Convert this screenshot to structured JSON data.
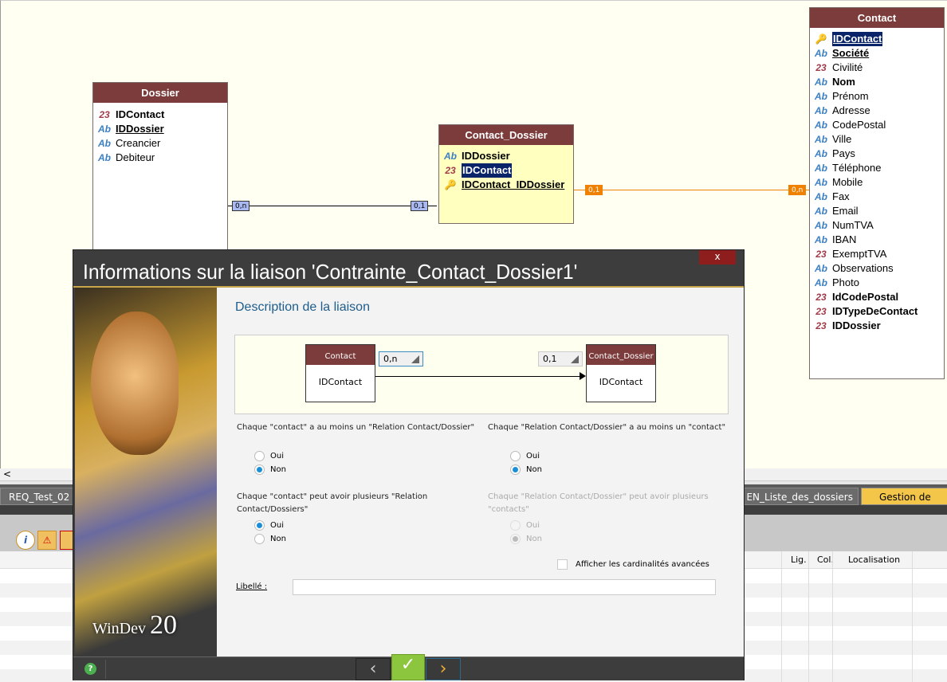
{
  "diagram": {
    "tables": [
      {
        "id": "dossier",
        "title": "Dossier",
        "fields": [
          {
            "name": "IDContact",
            "type": "num",
            "style": "b"
          },
          {
            "name": "IDDossier",
            "type": "ab",
            "style": "b u"
          },
          {
            "name": "Creancier",
            "type": "ab",
            "style": ""
          },
          {
            "name": "Debiteur",
            "type": "ab",
            "style": ""
          }
        ]
      },
      {
        "id": "contact_dossier",
        "title": "Contact_Dossier",
        "fields": [
          {
            "name": "IDDossier",
            "type": "ab",
            "style": "b"
          },
          {
            "name": "IDContact",
            "type": "num",
            "style": "b sel"
          },
          {
            "name": "IDContact_IDDossier",
            "type": "key",
            "style": "b u"
          }
        ]
      },
      {
        "id": "contact",
        "title": "Contact",
        "fields": [
          {
            "name": "IDContact",
            "type": "key",
            "style": "b u sel"
          },
          {
            "name": "Société",
            "type": "ab",
            "style": "b u"
          },
          {
            "name": "Civilité",
            "type": "num",
            "style": ""
          },
          {
            "name": "Nom",
            "type": "ab",
            "style": "b"
          },
          {
            "name": "Prénom",
            "type": "ab",
            "style": ""
          },
          {
            "name": "Adresse",
            "type": "ab",
            "style": ""
          },
          {
            "name": "CodePostal",
            "type": "ab",
            "style": ""
          },
          {
            "name": "Ville",
            "type": "ab",
            "style": ""
          },
          {
            "name": "Pays",
            "type": "ab",
            "style": ""
          },
          {
            "name": "Téléphone",
            "type": "ab",
            "style": ""
          },
          {
            "name": "Mobile",
            "type": "ab",
            "style": ""
          },
          {
            "name": "Fax",
            "type": "ab",
            "style": ""
          },
          {
            "name": "Email",
            "type": "ab",
            "style": ""
          },
          {
            "name": "NumTVA",
            "type": "ab",
            "style": ""
          },
          {
            "name": "IBAN",
            "type": "ab",
            "style": ""
          },
          {
            "name": "ExemptTVA",
            "type": "num",
            "style": ""
          },
          {
            "name": "Observations",
            "type": "ab",
            "style": ""
          },
          {
            "name": "Photo",
            "type": "ab",
            "style": ""
          },
          {
            "name": "IdCodePostal",
            "type": "num",
            "style": "b"
          },
          {
            "name": "IDTypeDeContact",
            "type": "num",
            "style": "b"
          },
          {
            "name": "IDDossier",
            "type": "num",
            "style": "b"
          }
        ]
      }
    ],
    "links": {
      "dossier_left": "0,n",
      "dossier_right": "0,1",
      "contact_left": "0,1",
      "contact_right": "0,n"
    },
    "icons": {
      "ab": "Ab",
      "num": "23",
      "key": "🔑"
    }
  },
  "tabs": [
    {
      "label": "REQ_Test_02"
    },
    {
      "label": "EN_Liste_des_dossiers"
    },
    {
      "label": "Gestion de créa"
    }
  ],
  "grid": {
    "columns": [
      "Lig.",
      "Col.",
      "Localisation"
    ]
  },
  "dialog": {
    "title": "Informations sur la liaison 'Contrainte_Contact_Dossier1'",
    "close": "x",
    "section": "Description de la liaison",
    "left_table": {
      "title": "Contact",
      "field": "IDContact",
      "cardinality": "0,n"
    },
    "right_table": {
      "title": "Contact_Dossier",
      "field": "IDContact",
      "cardinality": "0,1"
    },
    "q1": "Chaque \"contact\" a au moins un \"Relation Contact/Dossier\"",
    "q2": "Chaque \"Relation Contact/Dossier\" a au moins un \"contact\"",
    "q3": "Chaque \"contact\" peut avoir plusieurs \"Relation Contact/Dossiers\"",
    "q4": "Chaque \"Relation Contact/Dossier\" peut avoir plusieurs \"contacts\"",
    "oui": "Oui",
    "non": "Non",
    "answers": {
      "q1": "Non",
      "q2": "Non",
      "q3": "Oui",
      "q4": "Non"
    },
    "advanced_label": "Afficher les cardinalités avancées",
    "advanced_checked": false,
    "libelle_label": "Libellé :",
    "libelle_value": "",
    "logo": "WinDev",
    "logo_version": "20",
    "buttons": {
      "help": "?",
      "prev": "‹",
      "ok": "✓",
      "next": "›"
    }
  }
}
